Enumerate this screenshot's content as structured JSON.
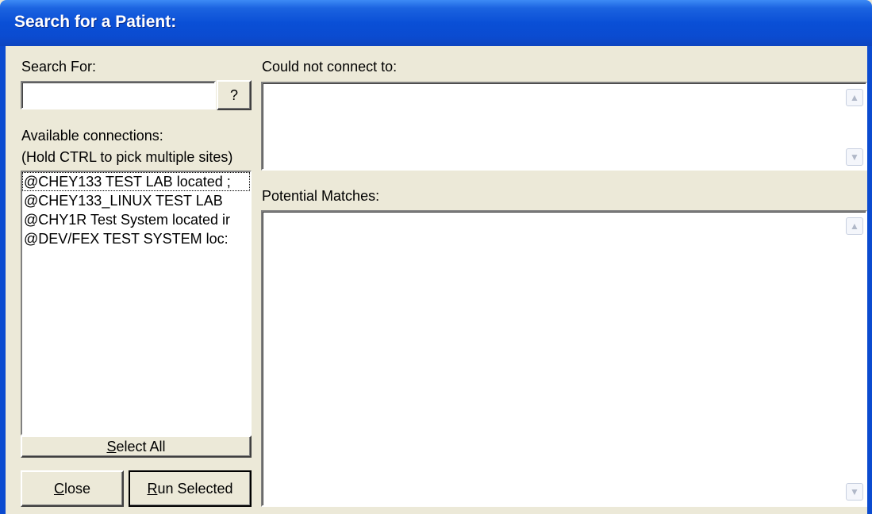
{
  "window": {
    "title": "Search for a Patient:"
  },
  "search": {
    "label": "Search For:",
    "value": "",
    "help_button": "?"
  },
  "connections": {
    "label": "Available connections:",
    "hint": "(Hold CTRL to pick multiple sites)",
    "items": [
      "@CHEY133 TEST LAB located ;",
      "@CHEY133_LINUX TEST LAB",
      "@CHY1R Test System located ir",
      "@DEV/FEX TEST SYSTEM loc:"
    ]
  },
  "buttons": {
    "select_all_prefix": "",
    "select_all_underline": "S",
    "select_all_rest": "elect All",
    "close_underline": "C",
    "close_rest": "lose",
    "run_underline": "R",
    "run_rest": "un Selected"
  },
  "panels": {
    "could_not_connect_label": "Could not connect to:",
    "potential_matches_label": "Potential Matches:"
  },
  "colors": {
    "title_bar": "#0b4bd0",
    "face": "#ece9d8"
  }
}
